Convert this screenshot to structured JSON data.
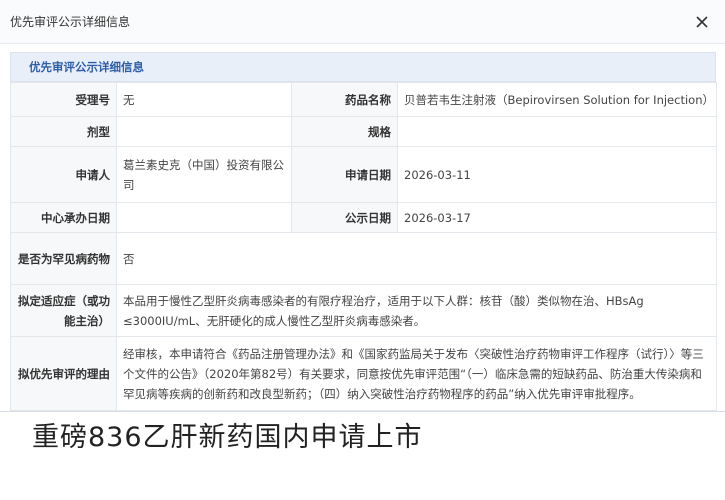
{
  "modal": {
    "title": "优先审评公示详细信息",
    "section_title": "优先审评公示详细信息"
  },
  "fields": {
    "accept_no": {
      "label": "受理号",
      "value": "无"
    },
    "drug_name": {
      "label": "药品名称",
      "value": "贝普若韦生注射液（Bepirovirsen Solution for Injection）"
    },
    "dosage_form": {
      "label": "剂型",
      "value": ""
    },
    "spec": {
      "label": "规格",
      "value": ""
    },
    "applicant": {
      "label": "申请人",
      "value": "葛兰素史克（中国）投资有限公司"
    },
    "apply_date": {
      "label": "申请日期",
      "value": "2026-03-11"
    },
    "center_date": {
      "label": "中心承办日期",
      "value": ""
    },
    "publish_date": {
      "label": "公示日期",
      "value": "2026-03-17"
    },
    "rare_disease": {
      "label": "是否为罕见病药物",
      "value": "否"
    },
    "indication": {
      "label": "拟定适应症（或功能主治）",
      "value": "本品用于慢性乙型肝炎病毒感染者的有限疗程治疗，适用于以下人群：核苷（酸）类似物在治、HBsAg ≤3000IU/mL、无肝硬化的成人慢性乙型肝炎病毒感染者。"
    },
    "reason": {
      "label": "拟优先审评的理由",
      "value": "经审核，本申请符合《药品注册管理办法》和《国家药监局关于发布〈突破性治疗药物审评工作程序（试行）〉等三个文件的公告》（2020年第82号）有关要求，同意按优先审评范围“（一）临床急需的短缺药品、防治重大传染病和罕见病等疾病的创新药和改良型新药；（四）纳入突破性治疗药物程序的药品”纳入优先审评审批程序。"
    }
  },
  "caption": "重磅836乙肝新药国内申请上市",
  "colors": {
    "accent": "#2e5ea8",
    "section_bg": "#e9eff9",
    "label_bg": "#f7f8fa"
  },
  "icons": {
    "close": "close-icon"
  }
}
